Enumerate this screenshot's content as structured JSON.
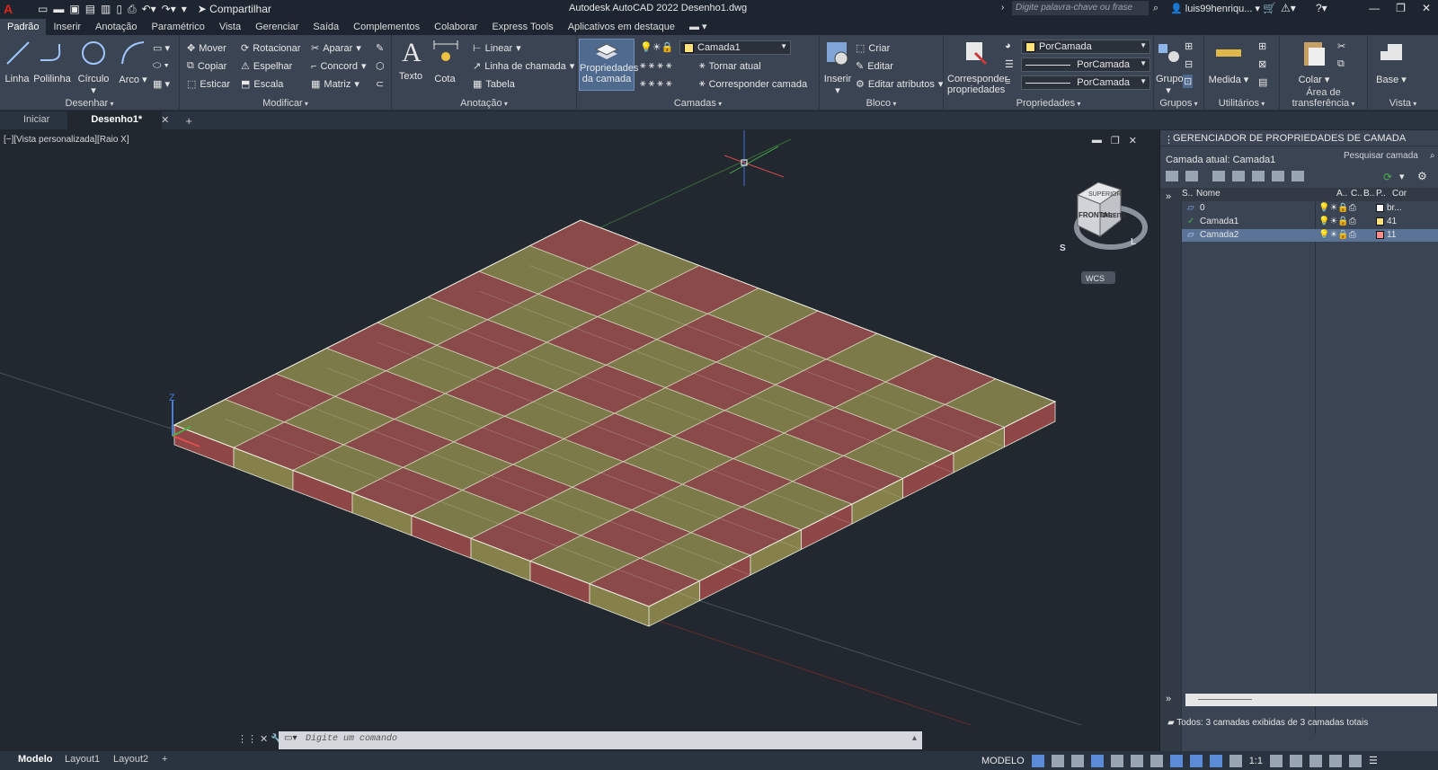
{
  "titlebar": {
    "app_logo": "A",
    "share_label": "Compartilhar",
    "title": "Autodesk AutoCAD 2022    Desenho1.dwg",
    "search_placeholder": "Digite palavra-chave ou frase",
    "user": "luis99henriqu..."
  },
  "ribbon_tabs": [
    "Padrão",
    "Inserir",
    "Anotação",
    "Paramétrico",
    "Vista",
    "Gerenciar",
    "Saída",
    "Complementos",
    "Colaborar",
    "Express Tools",
    "Aplicativos em destaque"
  ],
  "ribbon": {
    "desenhar": {
      "title": "Desenhar",
      "linha": "Linha",
      "polilinha": "Polilinha",
      "circulo": "Círculo",
      "arco": "Arco"
    },
    "modificar": {
      "title": "Modificar",
      "mover": "Mover",
      "rotacionar": "Rotacionar",
      "aparar": "Aparar",
      "copiar": "Copiar",
      "espelhar": "Espelhar",
      "concord": "Concord",
      "esticar": "Esticar",
      "escala": "Escala",
      "matriz": "Matriz"
    },
    "anotacao": {
      "title": "Anotação",
      "texto": "Texto",
      "cota": "Cota",
      "linear": "Linear",
      "linha_chamada": "Linha de chamada",
      "tabela": "Tabela"
    },
    "camadas": {
      "title": "Camadas",
      "propriedades_line1": "Propriedades",
      "propriedades_line2": "da camada",
      "current_layer": "Camada1",
      "tornar_atual": "Tornar atual",
      "corresponder": "Corresponder camada"
    },
    "bloco": {
      "title": "Bloco",
      "inserir": "Inserir",
      "criar": "Criar",
      "editar": "Editar",
      "editar_atributos": "Editar atributos"
    },
    "propriedades": {
      "title": "Propriedades",
      "corresp_line1": "Corresponder",
      "corresp_line2": "propriedades",
      "color": "PorCamada",
      "linetype": "PorCamada",
      "lineweight": "PorCamada"
    },
    "grupos": {
      "title": "Grupos",
      "grupo": "Grupo"
    },
    "utilitarios": {
      "title": "Utilitários",
      "medida": "Medida"
    },
    "transferencia": {
      "title": "Área de transferência",
      "colar": "Colar"
    },
    "vista": {
      "title": "Vista",
      "base": "Base"
    }
  },
  "doc_tabs": {
    "iniciar": "Iniciar",
    "desenho": "Desenho1*"
  },
  "viewport": {
    "label": "[−][Vista personalizada][Raio X]",
    "viewcube_top": "SUPERIOR",
    "viewcube_front": "FRONTAL",
    "viewcube_right": "DIREITA",
    "compass_s": "S",
    "compass_l": "L",
    "wcs": "WCS",
    "axis_z": "Z"
  },
  "layer_panel": {
    "title": "GERENCIADOR DE PROPRIEDADES DE CAMADA",
    "current": "Camada atual: Camada1",
    "search": "Pesquisar camada",
    "columns": {
      "s": "S..",
      "nome": "Nome",
      "a": "A..",
      "c": "C..",
      "b": "B..",
      "p": "P..",
      "cor": "Cor"
    },
    "rows": [
      {
        "name": "0",
        "color_label": "br...",
        "swatch": "#ffffff"
      },
      {
        "name": "Camada1",
        "color_label": "41",
        "swatch": "#ffe27a"
      },
      {
        "name": "Camada2",
        "color_label": "11",
        "swatch": "#ff8a8a"
      }
    ],
    "footer": "Todos: 3 camadas exibidas de 3 camadas totais"
  },
  "command": {
    "placeholder": "Digite um comando"
  },
  "layout_tabs": [
    "Modelo",
    "Layout1",
    "Layout2"
  ],
  "status": {
    "modelo": "MODELO",
    "scale": "1:1"
  },
  "colors": {
    "tile_red": "#8a4a4a",
    "tile_yellow": "#7d7a49",
    "accent": "#5b8bd6"
  }
}
